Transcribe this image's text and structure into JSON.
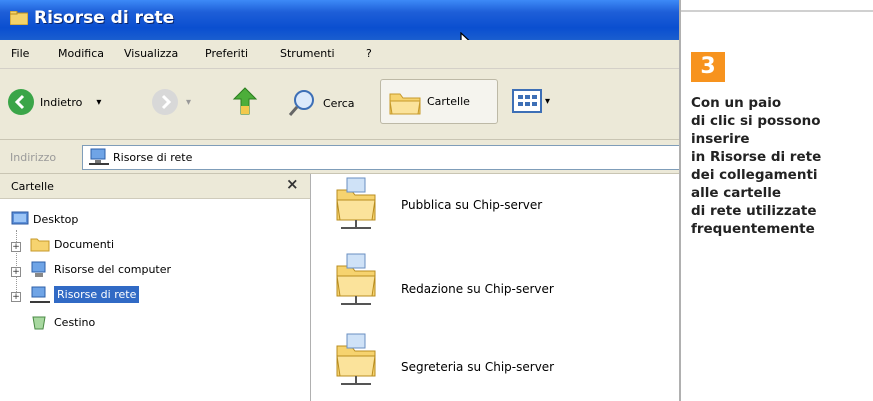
{
  "window": {
    "title": "Risorse di rete",
    "menu": [
      "File",
      "Modifica",
      "Visualizza",
      "Preferiti",
      "Strumenti",
      "?"
    ],
    "toolbar": {
      "back_label": "Indietro",
      "search_label": "Cerca",
      "folders_label": "Cartelle"
    },
    "address": {
      "label": "Indirizzo",
      "value": "Risorse di rete"
    },
    "folders_pane": {
      "title": "Cartelle",
      "close_glyph": "×",
      "tree": [
        {
          "label": "Desktop",
          "icon": "desktop-icon"
        },
        {
          "label": "Documenti",
          "icon": "folder-icon"
        },
        {
          "label": "Risorse del computer",
          "icon": "computer-icon"
        },
        {
          "label": "Risorse di rete",
          "icon": "network-icon",
          "selected": true
        },
        {
          "label": "Cestino",
          "icon": "recycle-bin-icon"
        }
      ]
    },
    "shares": [
      {
        "name": "Pubblica su Chip-server",
        "icon": "network-share-folder-icon"
      },
      {
        "name": "Redazione su Chip-server",
        "icon": "network-share-folder-icon"
      },
      {
        "name": "Segreteria su Chip-server",
        "icon": "network-share-folder-icon"
      }
    ]
  },
  "caption": {
    "step": "3",
    "text": "Con un paio\ndi clic si possono\ninserire\nin Risorse di rete\ndei collegamenti\nalle cartelle\ndi rete utilizzate\nfrequentemente"
  },
  "colors": {
    "titlebar": "#0a4fd0",
    "badge": "#f7931e",
    "selection": "#316ac5"
  }
}
